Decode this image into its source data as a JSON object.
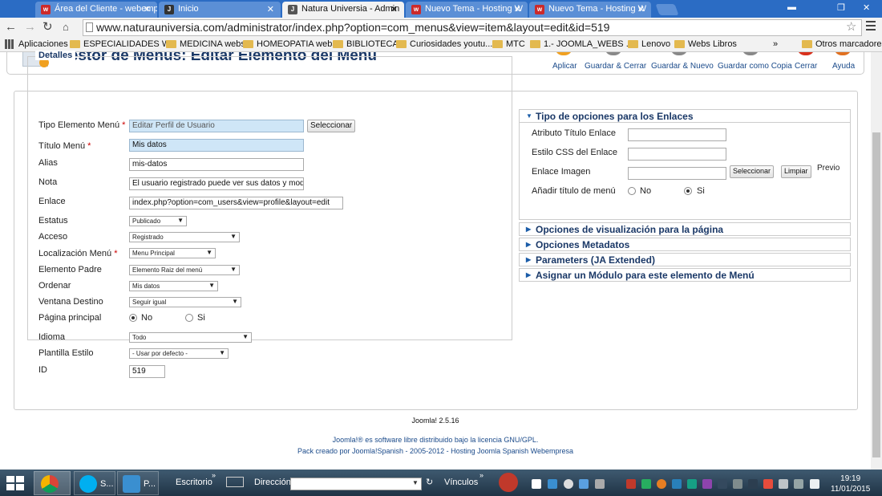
{
  "browser": {
    "tabs": [
      {
        "label": "Área del Cliente - webemp",
        "active": false
      },
      {
        "label": "Inicio",
        "active": false
      },
      {
        "label": "Natura Universia - Admin",
        "active": true
      },
      {
        "label": "Nuevo Tema - Hosting W",
        "active": false
      },
      {
        "label": "Nuevo Tema - Hosting W",
        "active": false
      }
    ],
    "url": "www.naturauniversia.com/administrator/index.php?option=com_menus&view=item&layout=edit&id=519",
    "bookmarks": [
      "Aplicaciones",
      "ESPECIALIDADES W...",
      "MEDICINA webs",
      "HOMEOPATIA webs",
      "BIBLIOTECA",
      "Curiosidades youtu...",
      "MTC",
      "1.- JOOMLA_WEBS ...",
      "Lenovo",
      "Webs Libros",
      "»",
      "Otros marcadores"
    ]
  },
  "header": {
    "title": "Gestor de Menús: Editar Elemento del Menú",
    "buttons": [
      "Aplicar",
      "Guardar & Cerrar",
      "Guardar & Nuevo",
      "Guardar como Copia",
      "Cerrar",
      "Ayuda"
    ]
  },
  "details": {
    "legend": "Detalles",
    "tipo_label": "Tipo Elemento Menú",
    "tipo_value": "Editar Perfil de Usuario",
    "tipo_button": "Seleccionar",
    "titulo_label": "Título Menú",
    "titulo_value": "Mis datos",
    "alias_label": "Alias",
    "alias_value": "mis-datos",
    "nota_label": "Nota",
    "nota_value": "El usuario registrado puede ver sus datos y modi",
    "enlace_label": "Enlace",
    "enlace_value": "index.php?option=com_users&view=profile&layout=edit",
    "estatus_label": "Estatus",
    "estatus_value": "Publicado",
    "acceso_label": "Acceso",
    "acceso_value": "Registrado",
    "localizacion_label": "Localización Menú",
    "localizacion_value": "Menu Principal",
    "padre_label": "Elemento Padre",
    "padre_value": "Elemento Raiz del menú",
    "ordenar_label": "Ordenar",
    "ordenar_value": "Mis datos",
    "ventana_label": "Ventana Destino",
    "ventana_value": "Seguir igual",
    "principal_label": "Página principal",
    "principal_no": "No",
    "principal_si": "Si",
    "idioma_label": "Idioma",
    "idioma_value": "Todo",
    "plantilla_label": "Plantilla Estilo",
    "plantilla_value": "- Usar por defecto -",
    "id_label": "ID",
    "id_value": "519",
    "required_mark": "*"
  },
  "link_options": {
    "heading": "Tipo de opciones para los Enlaces",
    "atributo_label": "Atributo Título Enlace",
    "css_label": "Estilo CSS del Enlace",
    "imagen_label": "Enlace Imagen",
    "select_button": "Seleccionar",
    "clear_button": "Limpiar",
    "preview_label": "Previo",
    "anadir_label": "Añadir título de menú",
    "anadir_no": "No",
    "anadir_si": "Si"
  },
  "accordion": [
    "Opciones de visualización para la página",
    "Opciones Metadatos",
    "Parameters (JA Extended)",
    "Asignar un Módulo para este elemento de Menú"
  ],
  "footer": {
    "version": "Joomla! 2.5.16",
    "license": "Joomla!® es software libre distribuido bajo la licencia GNU/GPL.",
    "pack": "Pack creado por Joomla!Spanish - 2005-2012 - Hosting Joomla Spanish Webempresa"
  },
  "taskbar": {
    "skype_label": "S...",
    "app2_label": "P...",
    "escritorio": "Escritorio",
    "direccion": "Dirección",
    "vinculos": "Vínculos",
    "time": "19:19",
    "date": "11/01/2015"
  },
  "colors": {
    "title": "#1a3867",
    "link": "#1a4a8a",
    "chrome_blue": "#2b6cc4",
    "taskbar": "#2b4458"
  }
}
